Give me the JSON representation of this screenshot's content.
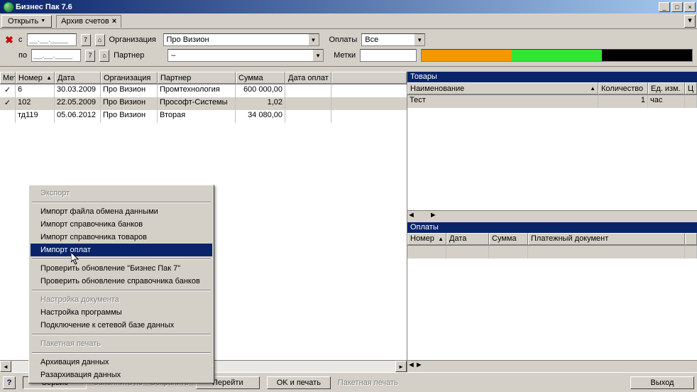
{
  "window": {
    "title": "Бизнес Пак 7.6"
  },
  "tabs": {
    "open_btn": "Открыть",
    "active_tab": "Архив счетов"
  },
  "filters": {
    "from_label": "с",
    "to_label": "по",
    "date_placeholder": "__.__.____",
    "org_label": "Организация",
    "org_value": "Про Визион",
    "partner_label": "Партнер",
    "partner_value": "–",
    "pay_label": "Оплаты",
    "pay_value": "Все",
    "marks_label": "Метки"
  },
  "main_grid": {
    "columns": [
      "Мет",
      "Номер",
      "Дата",
      "Организация",
      "Партнер",
      "Сумма",
      "Дата оплат"
    ],
    "rows": [
      {
        "check": true,
        "num": "6",
        "date": "30.03.2009",
        "org": "Про Визион",
        "partner": "Промтехнология",
        "sum": "600 000,00",
        "pdate": ""
      },
      {
        "check": true,
        "num": "102",
        "date": "22.05.2009",
        "org": "Про Визион",
        "partner": "Прософт-Системы",
        "sum": "1,02",
        "pdate": "",
        "selected": true
      },
      {
        "check": false,
        "num": "тд119",
        "date": "05.06.2012",
        "org": "Про Визион",
        "partner": "Вторая",
        "sum": "34 080,00",
        "pdate": ""
      }
    ]
  },
  "goods": {
    "title": "Товары",
    "columns": [
      "Наименование",
      "Количество",
      "Ед. изм.",
      "Ц"
    ],
    "rows": [
      {
        "name": "Тест",
        "qty": "1",
        "unit": "час"
      }
    ]
  },
  "payments": {
    "title": "Оплаты",
    "columns": [
      "Номер",
      "Дата",
      "Сумма",
      "Платежный документ"
    ]
  },
  "context_menu": {
    "items": [
      {
        "label": "Экспорт",
        "disabled": true
      },
      {
        "sep": true
      },
      {
        "label": "Импорт файла обмена данными"
      },
      {
        "label": "Импорт справочника банков"
      },
      {
        "label": "Импорт справочника товаров"
      },
      {
        "label": "Импорт оплат",
        "highlight": true
      },
      {
        "sep": true
      },
      {
        "label": "Проверить обновление \"Бизнес Пак 7\""
      },
      {
        "label": "Проверить обновление справочника банков"
      },
      {
        "sep": true
      },
      {
        "label": "Настройка документа",
        "disabled": true
      },
      {
        "label": "Настройка программы"
      },
      {
        "label": "Подключение к сетевой базе данных"
      },
      {
        "sep": true
      },
      {
        "label": "Пакетная печать",
        "disabled": true
      },
      {
        "sep": true
      },
      {
        "label": "Архивация данных"
      },
      {
        "label": "Разархивация данных"
      }
    ]
  },
  "statusbar": {
    "service": "Сервис",
    "fill": "Заполнить по",
    "save": "Сохранить",
    "goto": "Перейти",
    "okprint": "OK и печать",
    "batch": "Пакетная печать",
    "exit": "Выход"
  },
  "colors": {
    "orange": "#f39800",
    "green": "#33e533",
    "black": "#000000"
  }
}
